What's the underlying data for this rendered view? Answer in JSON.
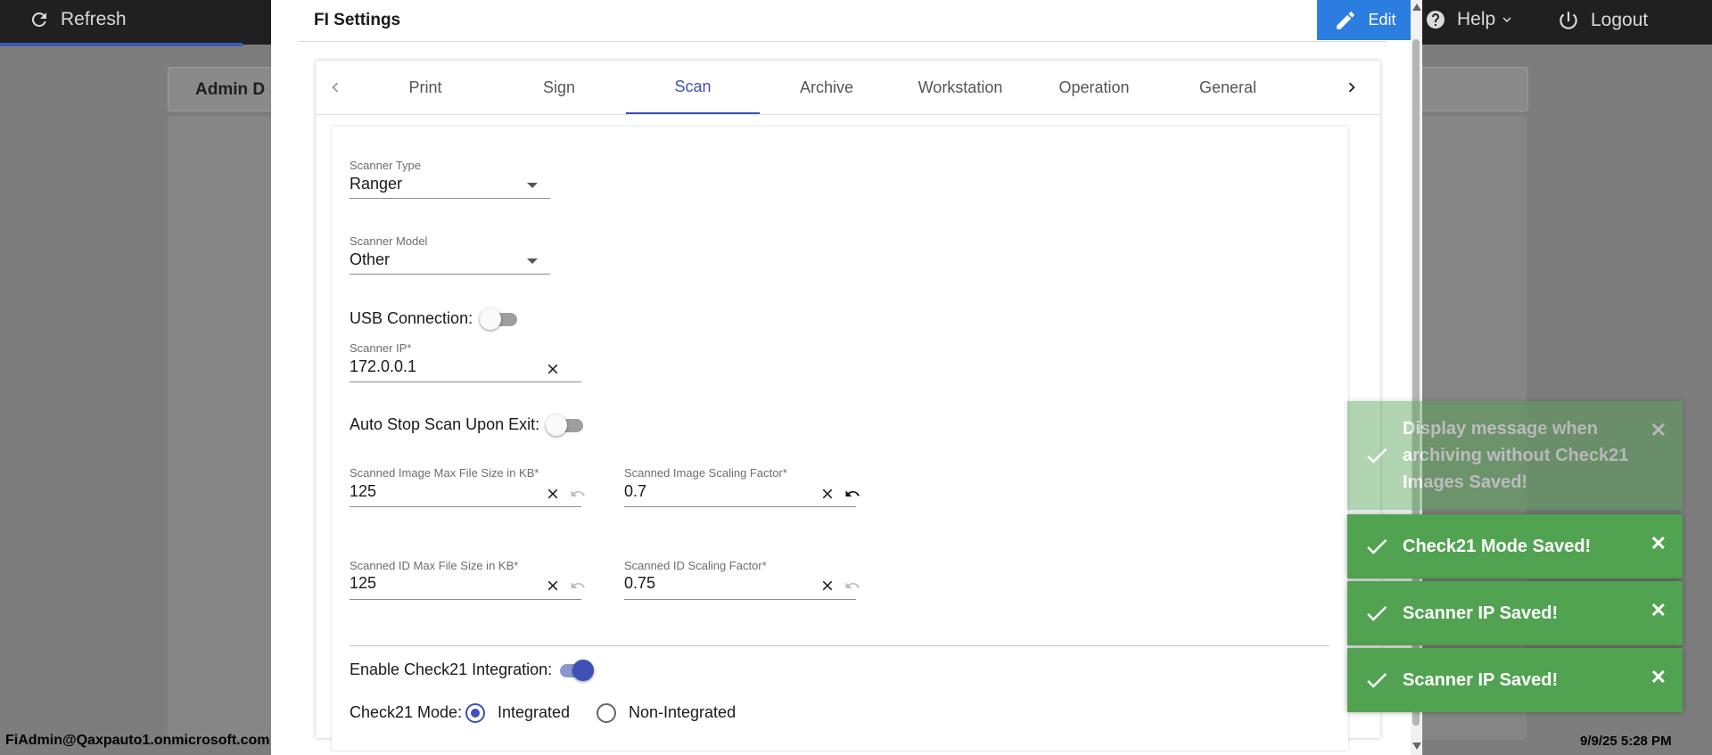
{
  "topbar": {
    "refresh_label": "Refresh",
    "help_label": "Help",
    "logout_label": "Logout"
  },
  "background": {
    "admin_card_text": "Admin D"
  },
  "footer": {
    "user_email": "FiAdmin@Qaxpauto1.onmicrosoft.com",
    "datetime": "9/9/25 5:28 PM"
  },
  "dialog": {
    "title": "FI Settings",
    "edit_label": "Edit",
    "tabs": [
      "Print",
      "Sign",
      "Scan",
      "Archive",
      "Workstation",
      "Operation",
      "General"
    ],
    "active_tab": "Scan"
  },
  "scan": {
    "scanner_type": {
      "label": "Scanner Type",
      "value": "Ranger"
    },
    "scanner_model": {
      "label": "Scanner Model",
      "value": "Other"
    },
    "usb_connection": {
      "label": "USB Connection:",
      "on": false
    },
    "scanner_ip": {
      "label": "Scanner IP*",
      "value": "172.0.0.1"
    },
    "auto_stop": {
      "label": "Auto Stop Scan Upon Exit:",
      "on": false
    },
    "image_max_size": {
      "label": "Scanned Image Max File Size in KB*",
      "value": "125"
    },
    "image_scaling": {
      "label": "Scanned Image Scaling Factor*",
      "value": "0.7"
    },
    "id_max_size": {
      "label": "Scanned ID Max File Size in KB*",
      "value": "125"
    },
    "id_scaling": {
      "label": "Scanned ID Scaling Factor*",
      "value": "0.75"
    },
    "check21_integration": {
      "label": "Enable Check21 Integration:",
      "on": true
    },
    "check21_mode": {
      "label": "Check21 Mode:",
      "options": [
        "Integrated",
        "Non-Integrated"
      ],
      "selected": "Integrated"
    }
  },
  "toasts": [
    {
      "message": "Display message when archiving without Check21 Images Saved!",
      "faded": true
    },
    {
      "message": "Check21 Mode Saved!",
      "faded": false
    },
    {
      "message": "Scanner IP Saved!",
      "faded": false
    },
    {
      "message": "Scanner IP Saved!",
      "faded": false
    }
  ],
  "colors": {
    "accent": "#3f51b5",
    "edit_button": "#2b7de0",
    "toast_success": "#51a351",
    "topbar": "#202020"
  }
}
